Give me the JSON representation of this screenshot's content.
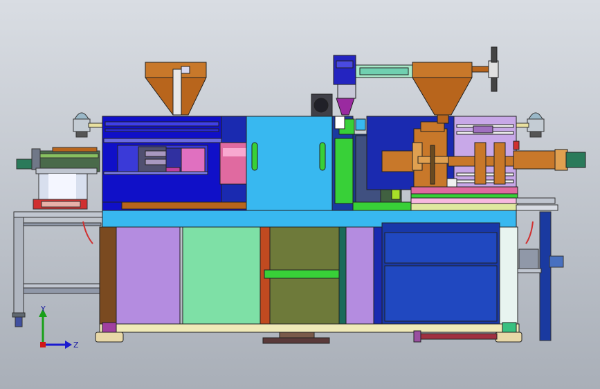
{
  "viewport": {
    "background_top": "#d9dde3",
    "background_bottom": "#a9afb8"
  },
  "triad": {
    "y_label": "Y",
    "z_label": "Z",
    "y_color": "#18a018",
    "z_color": "#1a1ad0",
    "origin_color": "#d01818"
  },
  "colors": {
    "hopper": "#b8651c",
    "barrel": "#c8782a",
    "frame_blue": "#1010c8",
    "cyan_panel": "#38b8f0",
    "purple_panel": "#b48ce0",
    "green_panel": "#7ee0a6",
    "olive_panel": "#6e7a3a",
    "navy_cabinet": "#1838a8",
    "base_cream": "#f0eab8",
    "steel": "#9aa0b0",
    "pink": "#e06aa0",
    "green": "#38d038"
  }
}
